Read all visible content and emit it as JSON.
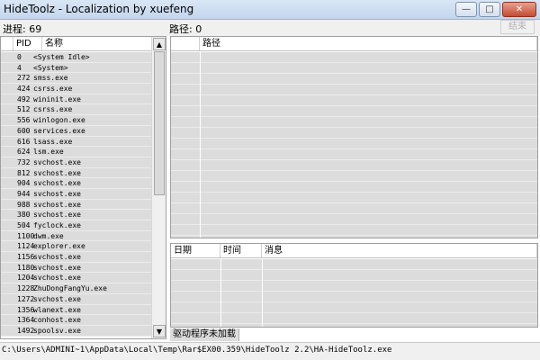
{
  "window": {
    "title": "HideToolz - Localization by xuefeng",
    "minimize_glyph": "—",
    "maximize_glyph": "□",
    "close_glyph": "✕"
  },
  "info": {
    "process_label": "进程: 69",
    "path_label": "路径: 0",
    "kill_button": "结束"
  },
  "process_list": {
    "headers": {
      "pid": "PID",
      "name": "名称"
    },
    "rows": [
      {
        "pid": "0",
        "name": "<System Idle>"
      },
      {
        "pid": "4",
        "name": "<System>"
      },
      {
        "pid": "272",
        "name": "smss.exe"
      },
      {
        "pid": "424",
        "name": "csrss.exe"
      },
      {
        "pid": "492",
        "name": "wininit.exe"
      },
      {
        "pid": "512",
        "name": "csrss.exe"
      },
      {
        "pid": "556",
        "name": "winlogon.exe"
      },
      {
        "pid": "600",
        "name": "services.exe"
      },
      {
        "pid": "616",
        "name": "lsass.exe"
      },
      {
        "pid": "624",
        "name": "lsm.exe"
      },
      {
        "pid": "732",
        "name": "svchost.exe"
      },
      {
        "pid": "812",
        "name": "svchost.exe"
      },
      {
        "pid": "904",
        "name": "svchost.exe"
      },
      {
        "pid": "944",
        "name": "svchost.exe"
      },
      {
        "pid": "988",
        "name": "svchost.exe"
      },
      {
        "pid": "380",
        "name": "svchost.exe"
      },
      {
        "pid": "504",
        "name": "fyclock.exe"
      },
      {
        "pid": "1100",
        "name": "dwm.exe"
      },
      {
        "pid": "1124",
        "name": "explorer.exe"
      },
      {
        "pid": "1156",
        "name": "svchost.exe"
      },
      {
        "pid": "1180",
        "name": "svchost.exe"
      },
      {
        "pid": "1204",
        "name": "svchost.exe"
      },
      {
        "pid": "1228",
        "name": "ZhuDongFangYu.exe"
      },
      {
        "pid": "1272",
        "name": "svchost.exe"
      },
      {
        "pid": "1356",
        "name": "wlanext.exe"
      },
      {
        "pid": "1364",
        "name": "conhost.exe"
      },
      {
        "pid": "1492",
        "name": "spoolsv.exe"
      }
    ],
    "scroll_up_glyph": "▲",
    "scroll_down_glyph": "▼"
  },
  "path_panel": {
    "header": "路径"
  },
  "log_panel": {
    "headers": {
      "date": "日期",
      "time": "时间",
      "message": "消息"
    }
  },
  "driver_status": "驱动程序未加载",
  "status_bar": {
    "path": "C:\\Users\\ADMINI~1\\AppData\\Local\\Temp\\Rar$EX00.359\\HideToolz 2.2\\HA-HideToolz.exe"
  }
}
